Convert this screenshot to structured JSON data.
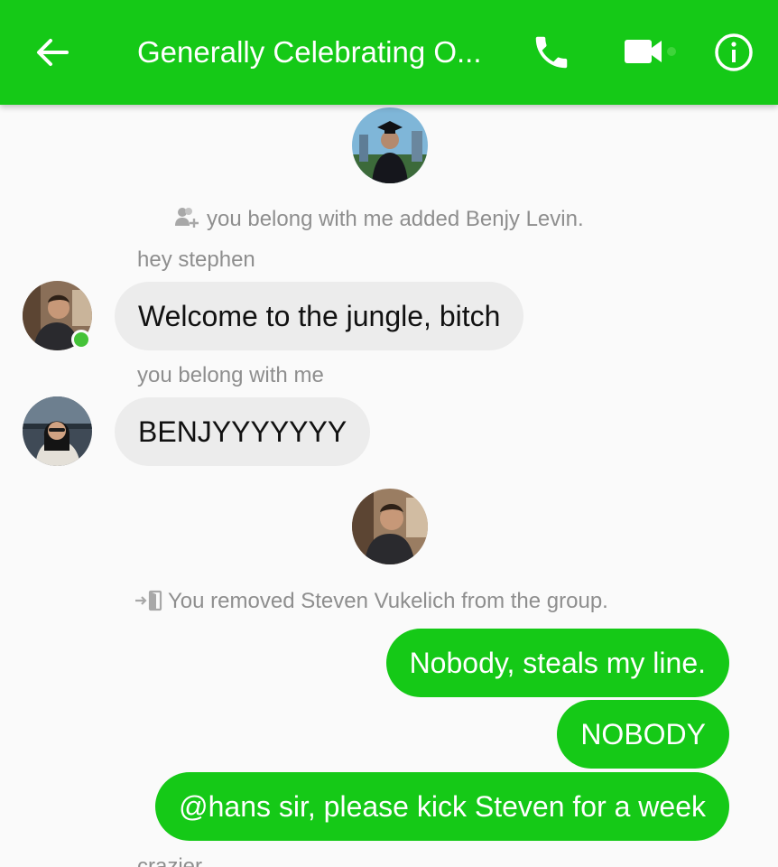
{
  "header": {
    "title": "Generally Celebrating O...",
    "accent_color": "#15c917",
    "icons": [
      "back-arrow-icon",
      "phone-icon",
      "video-camera-icon",
      "info-icon"
    ]
  },
  "thread": {
    "events": [
      {
        "type": "system",
        "icon": "add-person-icon",
        "text": "you belong with me added Benjy Levin."
      },
      {
        "type": "incoming",
        "sender": "hey stephen",
        "text": "Welcome to the jungle, bitch",
        "online": true
      },
      {
        "type": "incoming",
        "sender": "you belong with me",
        "text": "BENJYYYYYYY"
      },
      {
        "type": "system",
        "icon": "leave-door-icon",
        "text": "You removed Steven Vukelich from the group."
      },
      {
        "type": "outgoing",
        "text": "Nobody, steals my line."
      },
      {
        "type": "outgoing",
        "text": "NOBODY"
      },
      {
        "type": "outgoing",
        "text": "@hans sir, please kick Steven for a week"
      },
      {
        "type": "sender-partial",
        "text": "crazier"
      }
    ]
  }
}
